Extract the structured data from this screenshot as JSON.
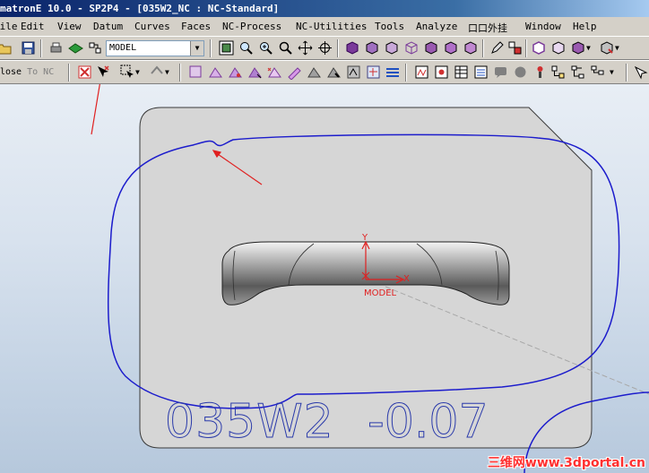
{
  "window": {
    "title": "matronE 10.0 - SP2P4 - [035W2_NC : NC-Standard]"
  },
  "menu": {
    "items": [
      "File",
      "Edit",
      "View",
      "Datum",
      "Curves",
      "Faces",
      "NC-Process",
      "NC-Utilities",
      "Tools",
      "Analyze",
      "口口外挂",
      "Window",
      "Help"
    ]
  },
  "toolbar": {
    "model_combo": "MODEL",
    "close_label": "lose",
    "to_nc_label": "To NC"
  },
  "viewport": {
    "part_label": "035W2",
    "part_value": "-0.07",
    "axis_y": "Y",
    "axis_x": "X",
    "axis_model": "MODEL"
  },
  "watermark": "三维网www.3dportal.cn",
  "colors": {
    "title_start": "#0a246a",
    "toolpath": "#1c1ccc",
    "annotation_arrow": "#e02020",
    "axis": "#e02020"
  }
}
